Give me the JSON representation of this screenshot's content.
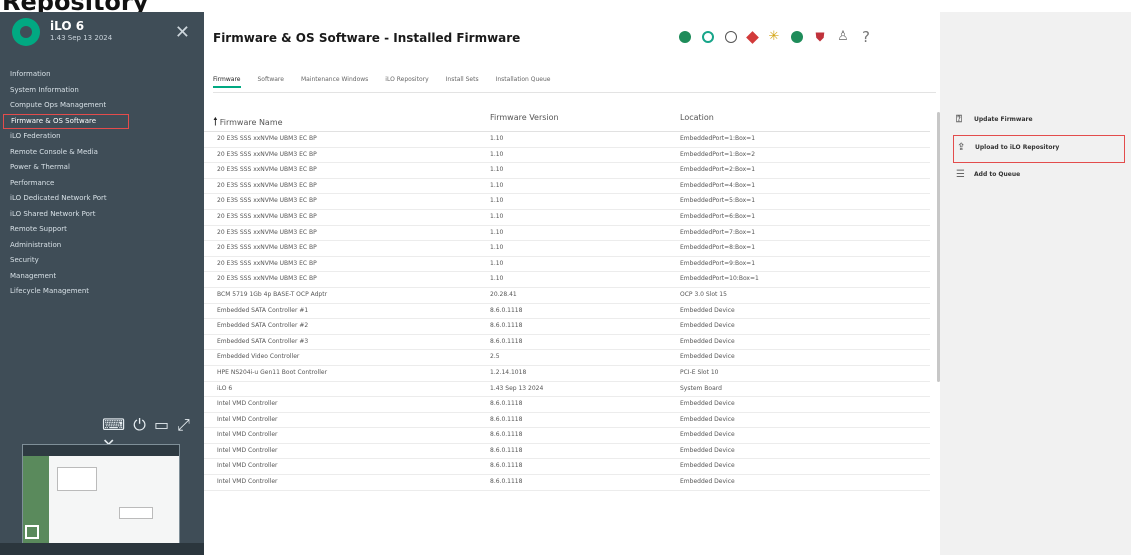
{
  "app": {
    "top_crop_text": "Repository",
    "title": "iLO 6",
    "subtitle": "1.43 Sep 13 2024"
  },
  "sidebar": {
    "items": [
      {
        "label": "Information"
      },
      {
        "label": "System Information"
      },
      {
        "label": "Compute Ops Management"
      },
      {
        "label": "Firmware & OS Software",
        "active": true
      },
      {
        "label": "iLO Federation"
      },
      {
        "label": "Remote Console & Media"
      },
      {
        "label": "Power & Thermal"
      },
      {
        "label": "Performance"
      },
      {
        "label": "iLO Dedicated Network Port"
      },
      {
        "label": "iLO Shared Network Port"
      },
      {
        "label": "Remote Support"
      },
      {
        "label": "Administration"
      },
      {
        "label": "Security"
      },
      {
        "label": "Management"
      },
      {
        "label": "Lifecycle Management"
      }
    ],
    "tool_icons": [
      "keyboard-icon",
      "power-icon",
      "remote-console-icon",
      "expand-icon",
      "close-icon"
    ]
  },
  "header": {
    "page_title": "Firmware & OS Software - Installed Firmware",
    "status_icons": [
      "health-status-icon",
      "system-status-icon",
      "network-icon",
      "alert-icon",
      "power-icon",
      "activity-icon",
      "security-icon",
      "user-icon",
      "help-icon"
    ],
    "colors": {
      "accent": "#01a982",
      "alert": "#d23a3a",
      "highlight_border": "#e34c4c"
    }
  },
  "tabs": [
    {
      "label": "Firmware",
      "active": true
    },
    {
      "label": "Software"
    },
    {
      "label": "Maintenance Windows"
    },
    {
      "label": "iLO Repository"
    },
    {
      "label": "Install Sets"
    },
    {
      "label": "Installation Queue"
    }
  ],
  "table": {
    "columns": [
      "Firmware Name",
      "Firmware Version",
      "Location"
    ],
    "sort_column": "Firmware Name",
    "rows": [
      [
        "20 E3S SSS xxNVMe UBM3 EC BP",
        "1.10",
        "EmbeddedPort=1:Box=1"
      ],
      [
        "20 E3S SSS xxNVMe UBM3 EC BP",
        "1.10",
        "EmbeddedPort=1:Box=2"
      ],
      [
        "20 E3S SSS xxNVMe UBM3 EC BP",
        "1.10",
        "EmbeddedPort=2:Box=1"
      ],
      [
        "20 E3S SSS xxNVMe UBM3 EC BP",
        "1.10",
        "EmbeddedPort=4:Box=1"
      ],
      [
        "20 E3S SSS xxNVMe UBM3 EC BP",
        "1.10",
        "EmbeddedPort=5:Box=1"
      ],
      [
        "20 E3S SSS xxNVMe UBM3 EC BP",
        "1.10",
        "EmbeddedPort=6:Box=1"
      ],
      [
        "20 E3S SSS xxNVMe UBM3 EC BP",
        "1.10",
        "EmbeddedPort=7:Box=1"
      ],
      [
        "20 E3S SSS xxNVMe UBM3 EC BP",
        "1.10",
        "EmbeddedPort=8:Box=1"
      ],
      [
        "20 E3S SSS xxNVMe UBM3 EC BP",
        "1.10",
        "EmbeddedPort=9:Box=1"
      ],
      [
        "20 E3S SSS xxNVMe UBM3 EC BP",
        "1.10",
        "EmbeddedPort=10:Box=1"
      ],
      [
        "BCM 5719 1Gb 4p BASE-T OCP Adptr",
        "20.28.41",
        "OCP 3.0 Slot 15"
      ],
      [
        "Embedded SATA Controller #1",
        "8.6.0.1118",
        "Embedded Device"
      ],
      [
        "Embedded SATA Controller #2",
        "8.6.0.1118",
        "Embedded Device"
      ],
      [
        "Embedded SATA Controller #3",
        "8.6.0.1118",
        "Embedded Device"
      ],
      [
        "Embedded Video Controller",
        "2.5",
        "Embedded Device"
      ],
      [
        "HPE NS204i-u Gen11 Boot Controller",
        "1.2.14.1018",
        "PCI-E Slot 10"
      ],
      [
        "iLO 6",
        "1.43 Sep 13 2024",
        "System Board"
      ],
      [
        "Intel VMD Controller",
        "8.6.0.1118",
        "Embedded Device"
      ],
      [
        "Intel VMD Controller",
        "8.6.0.1118",
        "Embedded Device"
      ],
      [
        "Intel VMD Controller",
        "8.6.0.1118",
        "Embedded Device"
      ],
      [
        "Intel VMD Controller",
        "8.6.0.1118",
        "Embedded Device"
      ],
      [
        "Intel VMD Controller",
        "8.6.0.1118",
        "Embedded Device"
      ],
      [
        "Intel VMD Controller",
        "8.6.0.1118",
        "Embedded Device"
      ]
    ]
  },
  "actions": {
    "update_firmware": "Update Firmware",
    "upload_to_repository": "Upload to iLO Repository",
    "add_to_queue": "Add to Queue"
  }
}
